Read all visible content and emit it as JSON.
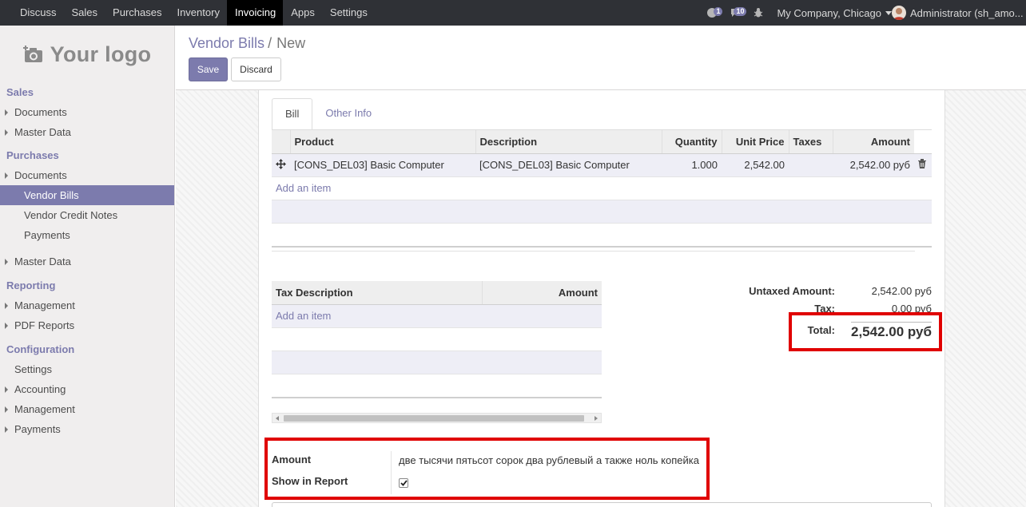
{
  "topbar": {
    "menu": [
      "Discuss",
      "Sales",
      "Purchases",
      "Inventory",
      "Invoicing",
      "Apps",
      "Settings"
    ],
    "active_menu": "Invoicing",
    "chat_count": "1",
    "msg_count": "10",
    "company": "My Company, Chicago",
    "user": "Administrator (sh_amo..."
  },
  "logo": {
    "text": "Your logo"
  },
  "sidebar": {
    "sales": {
      "title": "Sales",
      "items": [
        "Documents",
        "Master Data"
      ]
    },
    "purchases": {
      "title": "Purchases",
      "items": [
        "Documents",
        "Vendor Bills",
        "Vendor Credit Notes",
        "Payments",
        "Master Data"
      ]
    },
    "reporting": {
      "title": "Reporting",
      "items": [
        "Management",
        "PDF Reports"
      ]
    },
    "configuration": {
      "title": "Configuration",
      "items": [
        "Settings",
        "Accounting",
        "Management",
        "Payments"
      ]
    }
  },
  "breadcrumb": {
    "parent": "Vendor Bills",
    "separator": "/",
    "current": "New"
  },
  "buttons": {
    "save": "Save",
    "discard": "Discard"
  },
  "tabs": [
    "Bill",
    "Other Info"
  ],
  "lines": {
    "headers": [
      "Product",
      "Description",
      "Quantity",
      "Unit Price",
      "Taxes",
      "Amount"
    ],
    "rows": [
      {
        "product": "[CONS_DEL03] Basic Computer",
        "description": "[CONS_DEL03] Basic Computer",
        "quantity": "1.000",
        "unit_price": "2,542.00",
        "taxes": "",
        "amount": "2,542.00 руб"
      }
    ],
    "add_item": "Add an item"
  },
  "taxes": {
    "headers": [
      "Tax Description",
      "Amount"
    ],
    "add_item": "Add an item"
  },
  "totals": {
    "untaxed_label": "Untaxed Amount:",
    "untaxed_value": "2,542.00 руб",
    "tax_label": "Tax:",
    "tax_value": "0.00 руб",
    "total_label": "Total:",
    "total_value": "2,542.00 руб"
  },
  "amount_words": {
    "amount_label": "Amount",
    "amount_value": "две тысячи пятьсот сорок два рублевый а также ноль копейка",
    "show_label": "Show in Report",
    "show_checked": true
  },
  "colors": {
    "brand": "#7c7bad",
    "topbar": "#2f3136",
    "highlight": "#e00000"
  }
}
